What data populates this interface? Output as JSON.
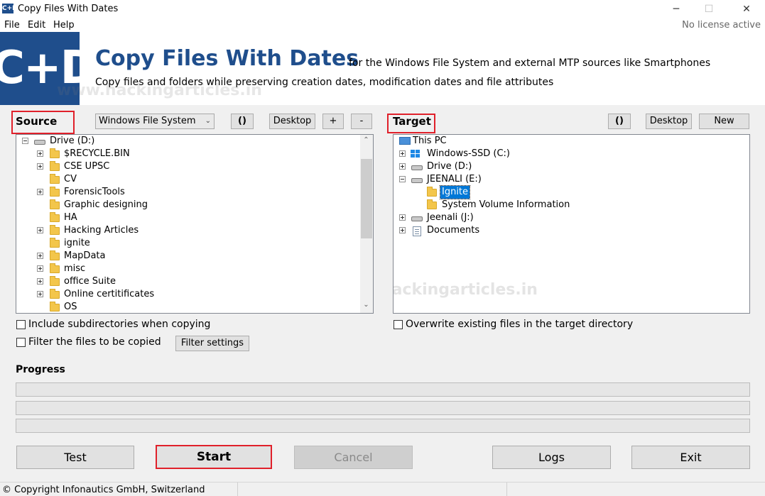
{
  "window": {
    "app_icon": "C+D",
    "title": "Copy Files With Dates",
    "minimize": "─",
    "maximize": "☐",
    "close": "✕"
  },
  "menu": {
    "items": [
      "File",
      "Edit",
      "Help"
    ],
    "license": "No license active"
  },
  "banner": {
    "logo": "C+D",
    "title": "Copy Files With Dates",
    "subtitle": "for the Windows File System and external MTP sources like Smartphones",
    "description": "Copy files and folders while preserving creation dates, modification dates and file attributes",
    "watermark": "www.hackingarticles.in"
  },
  "source": {
    "label": "Source",
    "filesystem": "Windows File System",
    "refresh": "()",
    "desktop": "Desktop",
    "add": "+",
    "remove": "-",
    "root": "Drive (D:)",
    "items": [
      {
        "label": "$RECYCLE.BIN",
        "expandable": true
      },
      {
        "label": "CSE UPSC",
        "expandable": true
      },
      {
        "label": "CV",
        "expandable": false
      },
      {
        "label": "ForensicTools",
        "expandable": true
      },
      {
        "label": "Graphic designing",
        "expandable": false
      },
      {
        "label": "HA",
        "expandable": false
      },
      {
        "label": "Hacking Articles",
        "expandable": true
      },
      {
        "label": "ignite",
        "expandable": false
      },
      {
        "label": "MapData",
        "expandable": true
      },
      {
        "label": "misc",
        "expandable": true
      },
      {
        "label": "office Suite",
        "expandable": true
      },
      {
        "label": "Online certitificates",
        "expandable": true
      },
      {
        "label": "OS",
        "expandable": false
      }
    ]
  },
  "target": {
    "label": "Target",
    "refresh": "()",
    "desktop": "Desktop",
    "new": "New",
    "root": "This PC",
    "drives": [
      {
        "label": "Windows-SSD (C:)"
      },
      {
        "label": "Drive (D:)"
      },
      {
        "label": "JEENALI (E:)"
      }
    ],
    "e_children": [
      {
        "label": "Ignite",
        "selected": true
      },
      {
        "label": "System Volume Information",
        "selected": false
      }
    ],
    "more": [
      {
        "label": "Jeenali (J:)"
      },
      {
        "label": "Documents"
      }
    ],
    "watermark": "www.hackingarticles.in"
  },
  "options": {
    "include_subdirs": "Include subdirectories when copying",
    "filter_files": "Filter the files to be copied",
    "filter_settings": "Filter settings",
    "overwrite": "Overwrite existing files in the target directory"
  },
  "progress": {
    "label": "Progress"
  },
  "actions": {
    "test": "Test",
    "start": "Start",
    "cancel": "Cancel",
    "logs": "Logs",
    "exit": "Exit"
  },
  "status": {
    "copyright": "© Copyright Infonautics GmbH, Switzerland"
  },
  "colors": {
    "brand": "#1f4e8c",
    "highlight": "#e0202a",
    "selection": "#0078d7"
  }
}
